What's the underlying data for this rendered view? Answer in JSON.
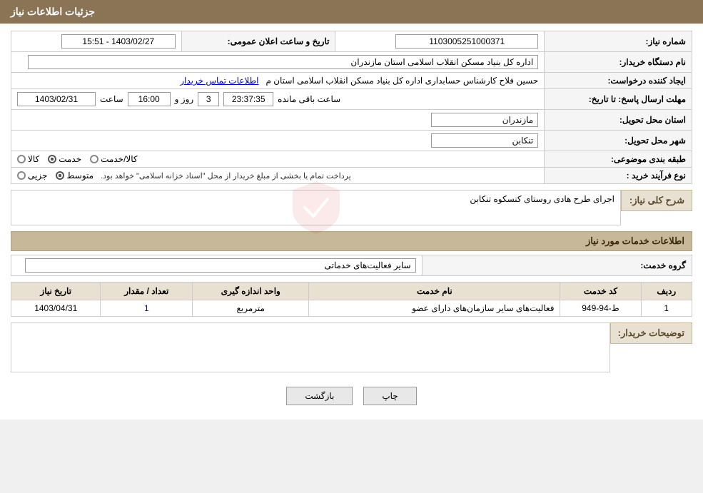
{
  "header": {
    "title": "جزئیات اطلاعات نیاز"
  },
  "fields": {
    "shomara_label": "شماره نیاز:",
    "shomara_value": "1103005251000371",
    "darestgah_label": "نام دستگاه خریدار:",
    "darestgah_value": "اداره کل بنیاد مسکن انقلاب اسلامی استان مازندران",
    "ijad_label": "ایجاد کننده درخواست:",
    "ijad_value": "حسین فلاح کارشناس حسابداری اداره کل بنیاد مسکن انقلاب اسلامی استان م",
    "ijad_link": "اطلاعات تماس خریدار",
    "mohlat_label": "مهلت ارسال پاسخ: تا تاریخ:",
    "date_value": "1403/02/31",
    "saat_label": "ساعت",
    "saat_value": "16:00",
    "rooz_label": "روز و",
    "rooz_value": "3",
    "baqi_label": "ساعت باقی مانده",
    "baqi_value": "23:37:35",
    "ostan_label": "استان محل تحویل:",
    "ostan_value": "مازندران",
    "shahr_label": "شهر محل تحویل:",
    "shahr_value": "تنکابن",
    "tabaqe_label": "طبقه بندی موضوعی:",
    "tabaqe_options": [
      "کالا",
      "خدمت",
      "کالا/خدمت"
    ],
    "tabaqe_selected": "خدمت",
    "noeFarayand_label": "نوع فرآیند خرید :",
    "noeFarayand_options": [
      "جزیی",
      "متوسط"
    ],
    "noeFarayand_selected": "متوسط",
    "noeFarayand_note": "پرداخت تمام یا بخشی از مبلغ خریدار از محل \"اسناد خزانه اسلامی\" خواهد بود.",
    "taarikh_ilan_label": "تاریخ و ساعت اعلان عمومی:",
    "taarikh_ilan_value": "1403/02/27 - 15:51",
    "sharh_label": "شرح کلی نیاز:",
    "sharh_value": "اجرای طرح هادی روستای کنسکوه تنکابن",
    "khadamat_label": "اطلاعات خدمات مورد نیاز",
    "gorohe_label": "گروه خدمت:",
    "gorohe_value": "سایر فعالیت‌های خدماتی",
    "table": {
      "headers": [
        "ردیف",
        "کد خدمت",
        "نام خدمت",
        "واحد اندازه گیری",
        "تعداد / مقدار",
        "تاریخ نیاز"
      ],
      "rows": [
        {
          "radif": "1",
          "kod": "ط-94-949",
          "name": "فعالیت‌های سایر سازمان‌های دارای عضو",
          "vahed": "مترمربع",
          "tedad": "1",
          "tarikh": "1403/04/31"
        }
      ]
    },
    "towzih_label": "توضیحات خریدار:",
    "towzih_value": ""
  },
  "buttons": {
    "print_label": "چاپ",
    "back_label": "بازگشت"
  }
}
